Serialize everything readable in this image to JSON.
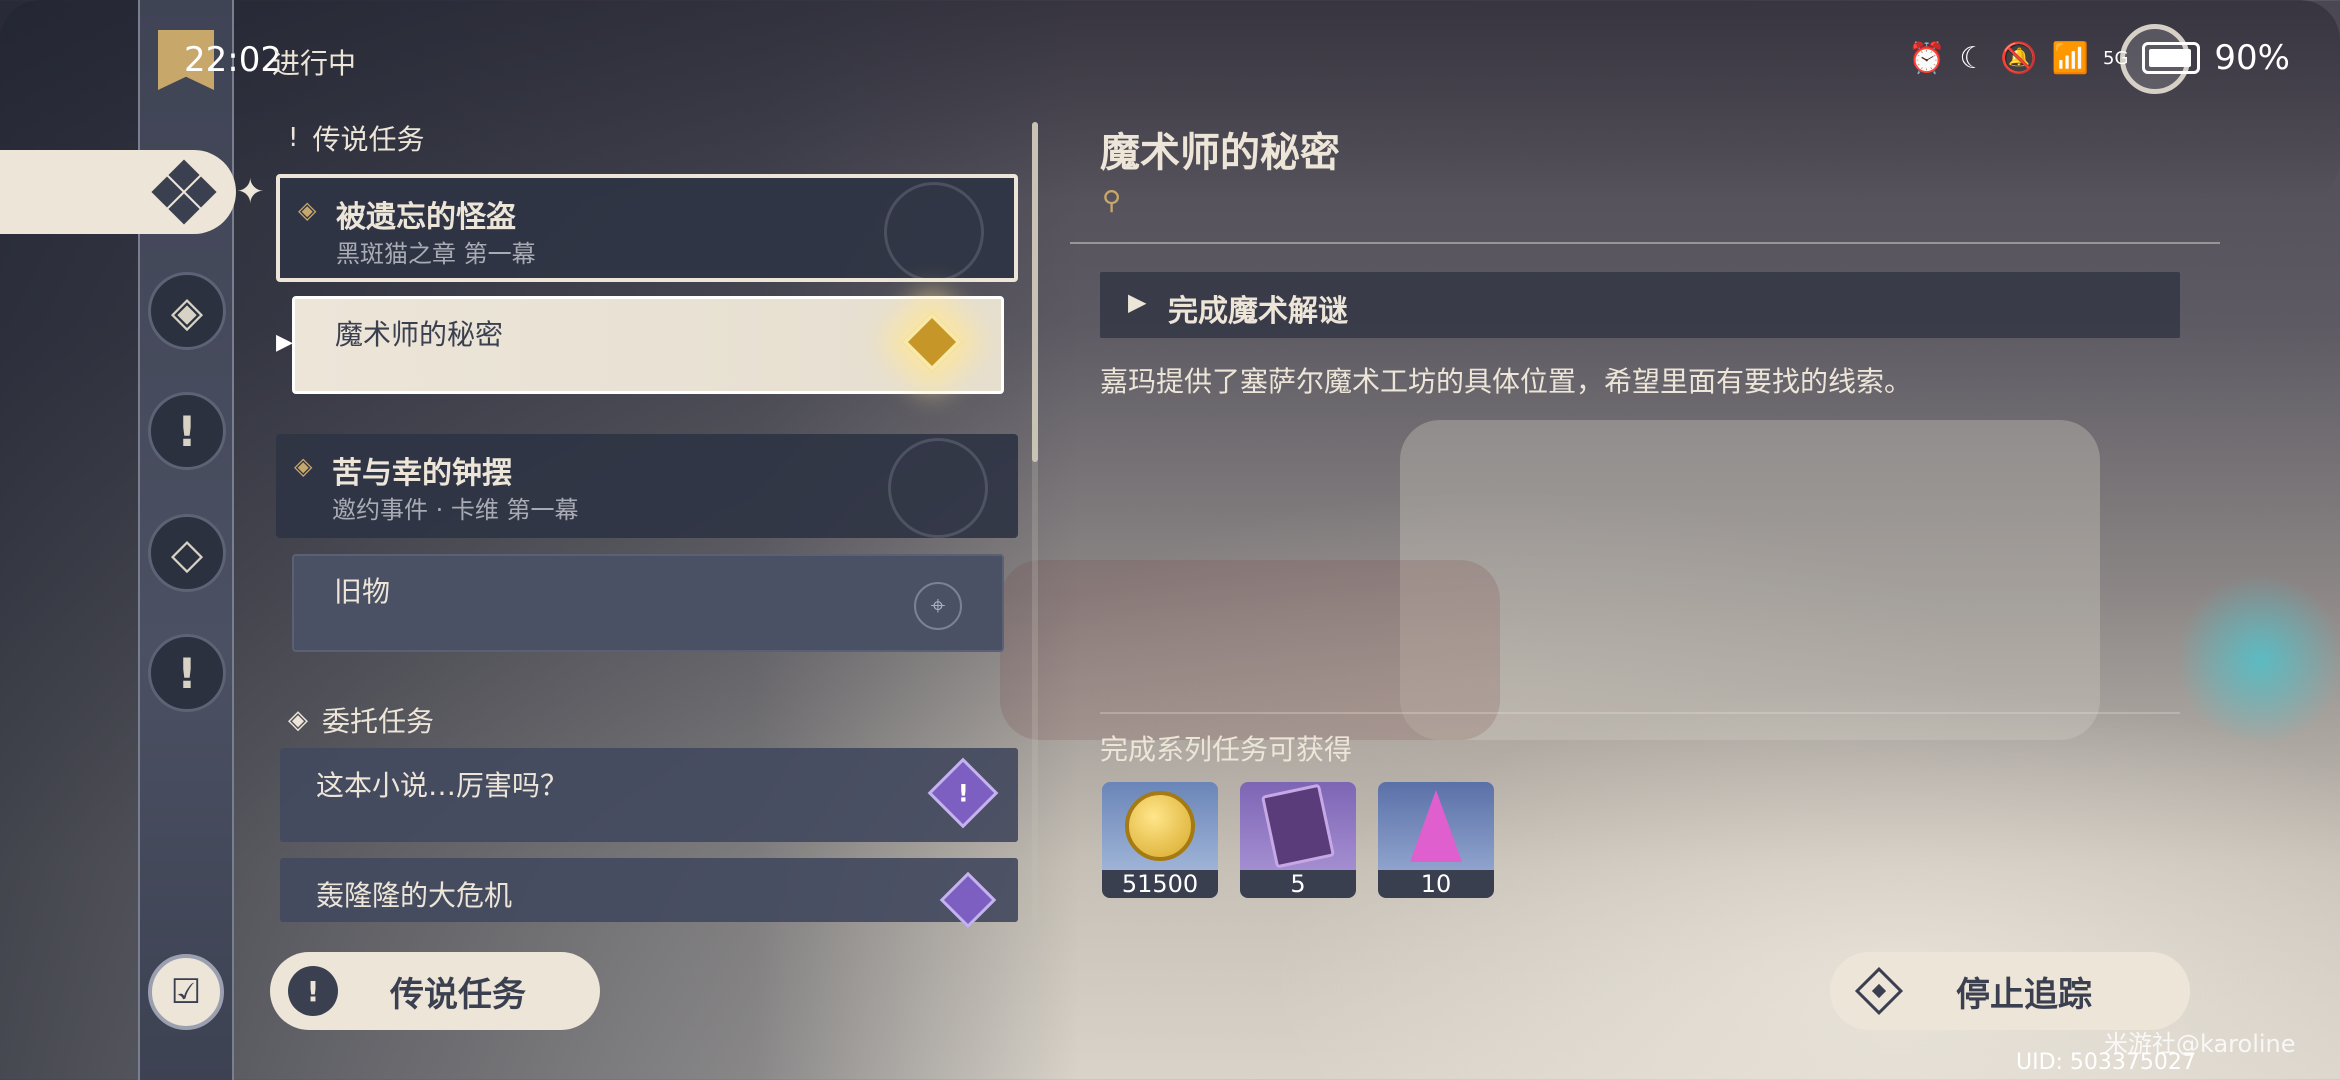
{
  "status_bar": {
    "time": "22:02",
    "battery": "90%",
    "network": "5G"
  },
  "header": {
    "tag": "进行中"
  },
  "sections": {
    "legend": "传说任务",
    "commission": "委托任务"
  },
  "legend_quests": [
    {
      "title": "被遗忘的怪盗",
      "subtitle": "黑斑猫之章 第一幕",
      "step": "魔术师的秘密"
    },
    {
      "title": "苦与幸的钟摆",
      "subtitle": "邀约事件 · 卡维 第一幕",
      "step": "旧物"
    }
  ],
  "commission_quests": [
    {
      "title": "这本小说…厉害吗？"
    },
    {
      "title": "轰隆隆的大危机"
    }
  ],
  "detail": {
    "title": "魔术师的秘密",
    "objective": "完成魔术解谜",
    "description": "嘉玛提供了塞萨尔魔术工坊的具体位置，希望里面有要找的线索。",
    "rewards_heading": "完成系列任务可获得",
    "rewards": [
      {
        "name": "mora",
        "count": "51500"
      },
      {
        "name": "book",
        "count": "5"
      },
      {
        "name": "crystal",
        "count": "10"
      }
    ]
  },
  "buttons": {
    "category": "传说任务",
    "stop": "停止追踪"
  },
  "footer": {
    "uid": "UID: 503375027",
    "watermark": "米游社@karoline"
  },
  "colors": {
    "panel": "#2f3444",
    "cream": "#ece5d8",
    "gold": "#c8a76a",
    "purple": "#7c5fc0"
  }
}
